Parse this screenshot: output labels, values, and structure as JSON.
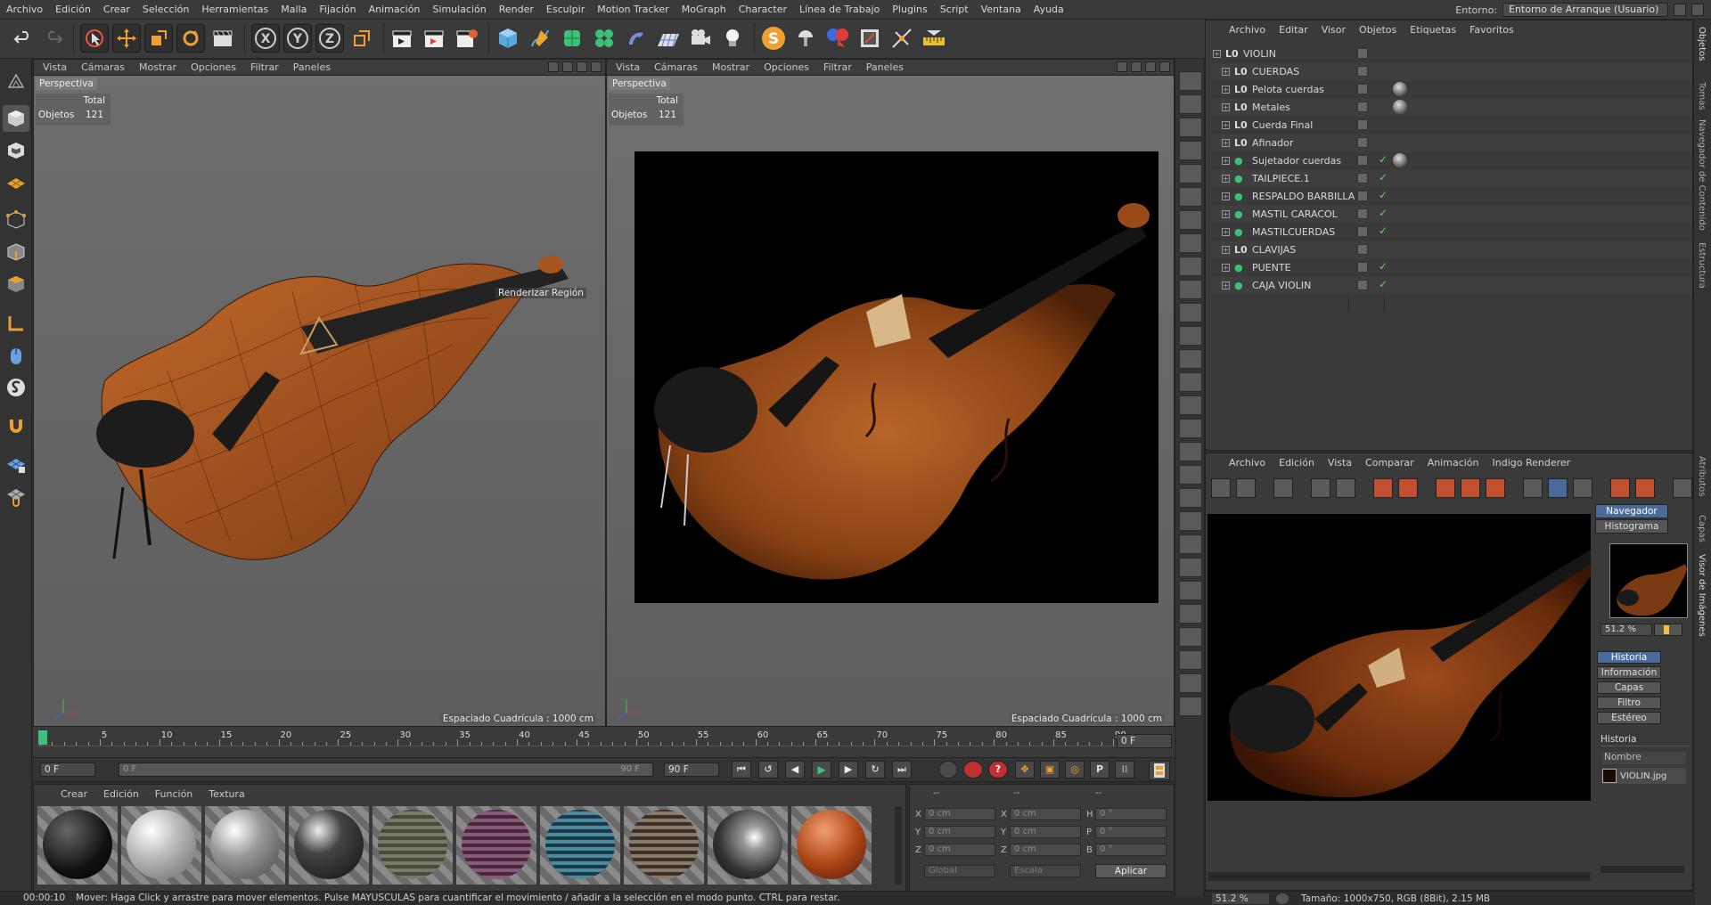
{
  "menu": [
    "Archivo",
    "Edición",
    "Crear",
    "Selección",
    "Herramientas",
    "Malla",
    "Fijación",
    "Animación",
    "Simulación",
    "Render",
    "Esculpir",
    "Motion Tracker",
    "MoGraph",
    "Character",
    "Línea de Trabajo",
    "Plugins",
    "Script",
    "Ventana",
    "Ayuda"
  ],
  "environment": {
    "label": "Entorno:",
    "value": "Entorno de Arranque (Usuario)"
  },
  "toolbar": {
    "x": "X",
    "y": "Y",
    "z": "Z",
    "s": "S"
  },
  "viewport_left": {
    "menu": [
      "Vista",
      "Cámaras",
      "Mostrar",
      "Opciones",
      "Filtrar",
      "Paneles"
    ],
    "camera": "Perspectiva",
    "stats_header": "Total",
    "stats_label": "Objetos",
    "stats_value": "121",
    "region_label": "Renderizar Región",
    "grid_note": "Espaciado Cuadrícula : 1000 cm"
  },
  "viewport_right": {
    "menu": [
      "Vista",
      "Cámaras",
      "Mostrar",
      "Opciones",
      "Filtrar",
      "Paneles"
    ],
    "camera": "Perspectiva",
    "stats_header": "Total",
    "stats_label": "Objetos",
    "stats_value": "121",
    "grid_note": "Espaciado Cuadrícula : 1000 cm"
  },
  "timeline": {
    "ticks": [
      "0",
      "5",
      "10",
      "15",
      "20",
      "25",
      "30",
      "35",
      "40",
      "45",
      "50",
      "55",
      "60",
      "65",
      "70",
      "75",
      "80",
      "85",
      "90"
    ],
    "end_frame": "0 F",
    "start_field": "0 F",
    "range_start": "0 F",
    "range_end": "90 F",
    "max_field": "90 F"
  },
  "materials": {
    "menu": [
      "Crear",
      "Edición",
      "Función",
      "Textura"
    ]
  },
  "coords": {
    "headers": [
      "--",
      "--",
      "--"
    ],
    "rows": [
      {
        "a": "X",
        "av": "0 cm",
        "b": "X",
        "bv": "0 cm",
        "c": "H",
        "cv": "0 °"
      },
      {
        "a": "Y",
        "av": "0 cm",
        "b": "Y",
        "bv": "0 cm",
        "c": "P",
        "cv": "0 °"
      },
      {
        "a": "Z",
        "av": "0 cm",
        "b": "Z",
        "bv": "0 cm",
        "c": "B",
        "cv": "0 °"
      }
    ],
    "mode1": "Global",
    "mode2": "Escala",
    "apply": "Aplicar"
  },
  "status": {
    "time": "00:00:10",
    "message": "Mover: Haga Click y arrastre para mover elementos. Pulse MAYUSCULAS para cuantificar el movimiento / añadir a la selección en el modo punto. CTRL para restar."
  },
  "objmgr": {
    "menu": [
      "Archivo",
      "Editar",
      "Visor",
      "Objetos",
      "Etiquetas",
      "Favoritos"
    ],
    "objects": [
      {
        "name": "VIOLIN",
        "type": "null",
        "indent": 0,
        "check": false,
        "tag": false
      },
      {
        "name": "CUERDAS",
        "type": "null",
        "indent": 1,
        "check": false,
        "tag": false
      },
      {
        "name": "Pelota cuerdas",
        "type": "null",
        "indent": 1,
        "check": false,
        "tag": true
      },
      {
        "name": "Metales",
        "type": "null",
        "indent": 1,
        "check": false,
        "tag": true
      },
      {
        "name": "Cuerda Final",
        "type": "null",
        "indent": 1,
        "check": false,
        "tag": false
      },
      {
        "name": "Afinador",
        "type": "null",
        "indent": 1,
        "check": false,
        "tag": false
      },
      {
        "name": "Sujetador cuerdas",
        "type": "gen",
        "indent": 1,
        "check": true,
        "tag": true
      },
      {
        "name": "TAILPIECE.1",
        "type": "gen",
        "indent": 1,
        "check": true,
        "tag": false
      },
      {
        "name": "RESPALDO BARBILLA",
        "type": "gen",
        "indent": 1,
        "check": true,
        "tag": false
      },
      {
        "name": "MASTIL CARACOL",
        "type": "gen",
        "indent": 1,
        "check": true,
        "tag": false
      },
      {
        "name": "MASTILCUERDAS",
        "type": "gen",
        "indent": 1,
        "check": true,
        "tag": false
      },
      {
        "name": "CLAVIJAS",
        "type": "null",
        "indent": 1,
        "check": false,
        "tag": false
      },
      {
        "name": "PUENTE",
        "type": "gen",
        "indent": 1,
        "check": true,
        "tag": false
      },
      {
        "name": "CAJA VIOLIN",
        "type": "gen",
        "indent": 1,
        "check": true,
        "tag": false
      }
    ]
  },
  "right_tabs": [
    "Objetos",
    "Tomas",
    "Navegador de Contenido",
    "Estructura",
    "Atributos",
    "Capas",
    "Visor de Imágenes"
  ],
  "picture_viewer": {
    "menu": [
      "Archivo",
      "Edición",
      "Vista",
      "Comparar",
      "Animación",
      "Indigo Renderer"
    ],
    "tab_navigator": "Navegador",
    "tab_histogram": "Histograma",
    "zoom": "51.2 %",
    "side_tabs": [
      "Historia",
      "Información",
      "Capas",
      "Filtro",
      "Estéreo"
    ],
    "history_title": "Historia",
    "history_col": "Nombre",
    "history_item": "VIOLIN.jpg",
    "footer_zoom": "51.2 %",
    "footer_info": "Tamaño: 1000x750, RGB (8Bit), 2.15 MB"
  }
}
